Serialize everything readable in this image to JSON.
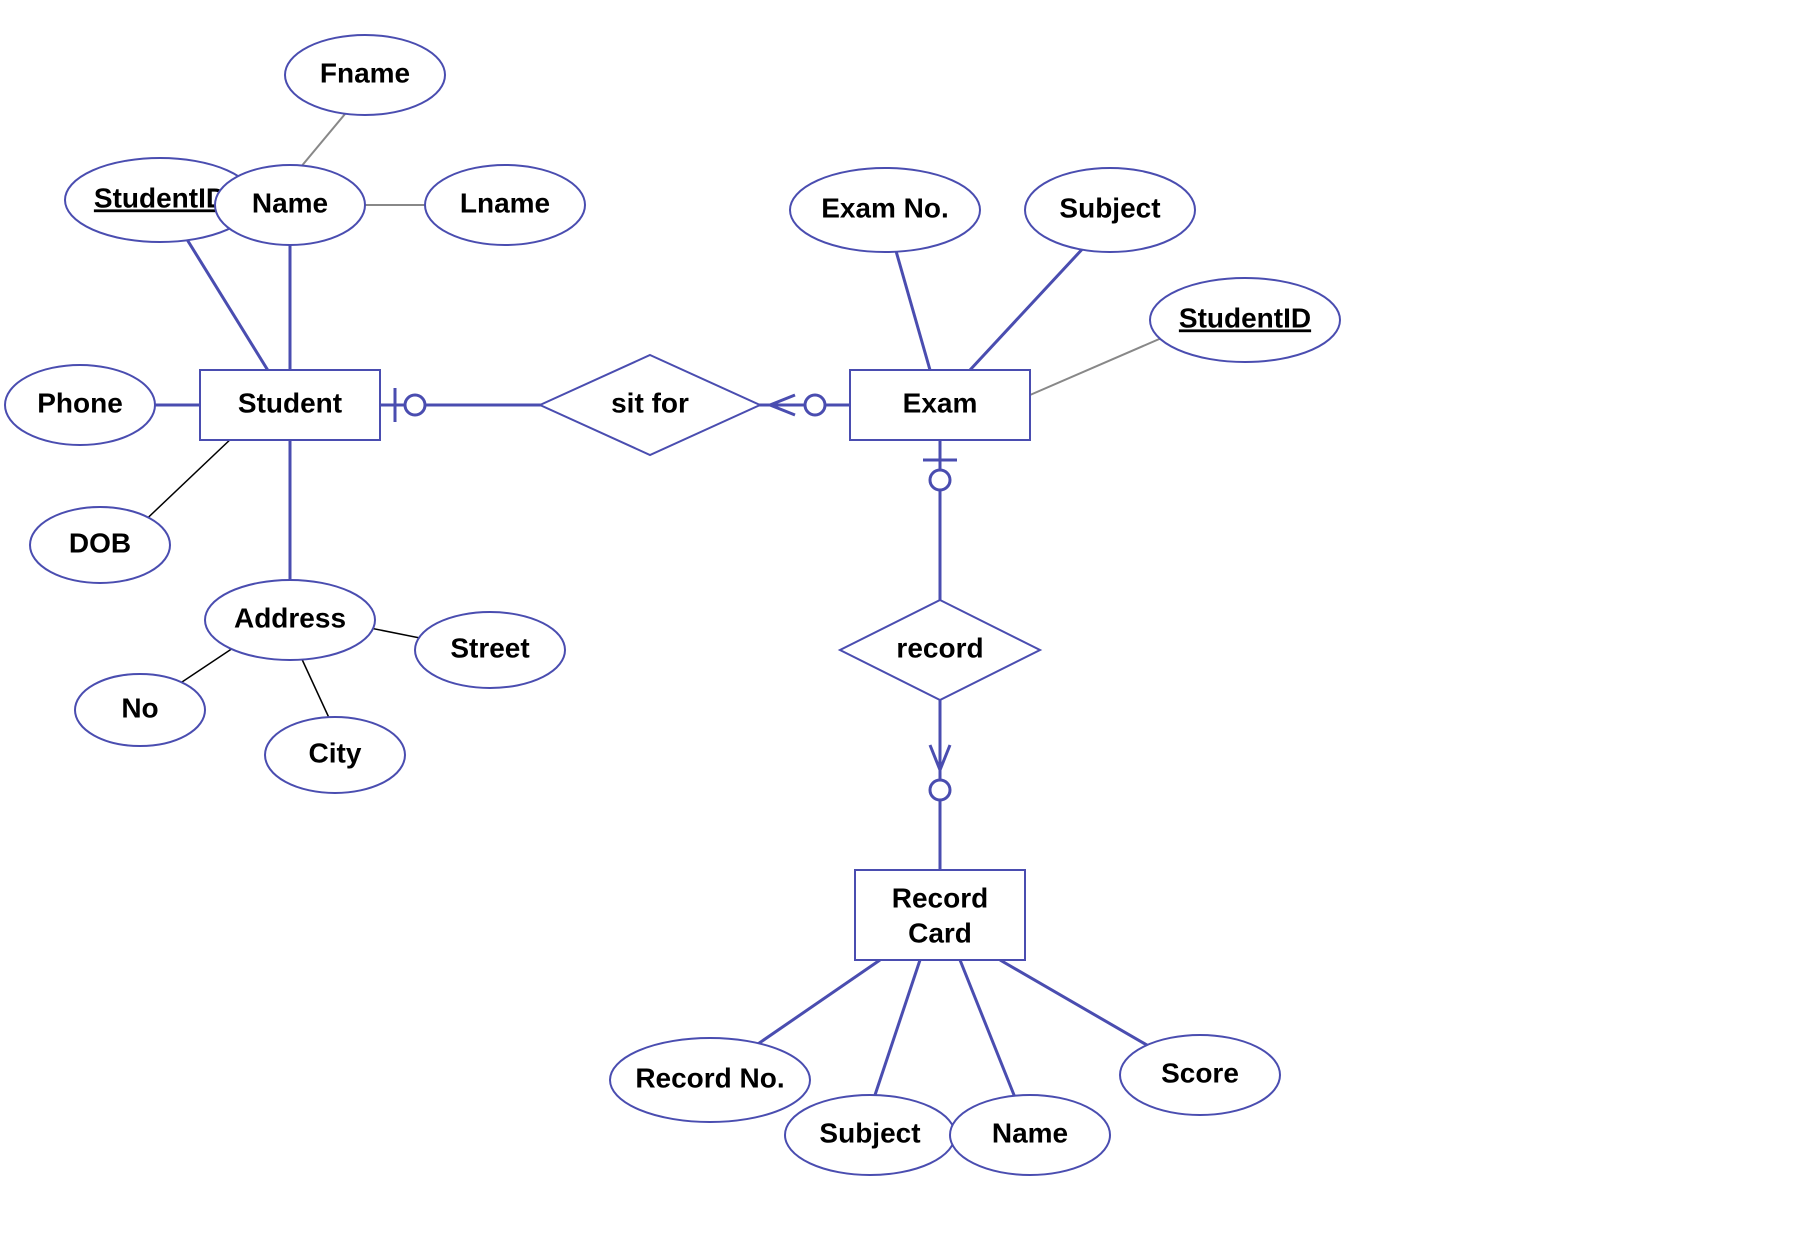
{
  "type": "er-diagram",
  "entities": {
    "student": {
      "label": "Student"
    },
    "exam": {
      "label": "Exam"
    },
    "record_card": {
      "label_line1": "Record",
      "label_line2": "Card"
    }
  },
  "relationships": {
    "sit_for": {
      "label": "sit for"
    },
    "record": {
      "label": "record"
    }
  },
  "attributes": {
    "student_id": {
      "label": "StudentID",
      "key": true
    },
    "name": {
      "label": "Name"
    },
    "fname": {
      "label": "Fname"
    },
    "lname": {
      "label": "Lname"
    },
    "phone": {
      "label": "Phone"
    },
    "dob": {
      "label": "DOB"
    },
    "address": {
      "label": "Address"
    },
    "no": {
      "label": "No"
    },
    "city": {
      "label": "City"
    },
    "street": {
      "label": "Street"
    },
    "exam_no": {
      "label": "Exam No."
    },
    "subject": {
      "label": "Subject"
    },
    "exam_student_id": {
      "label": "StudentID",
      "key": true
    },
    "record_no": {
      "label": "Record No."
    },
    "rc_subject": {
      "label": "Subject"
    },
    "rc_name": {
      "label": "Name"
    },
    "score": {
      "label": "Score"
    }
  }
}
